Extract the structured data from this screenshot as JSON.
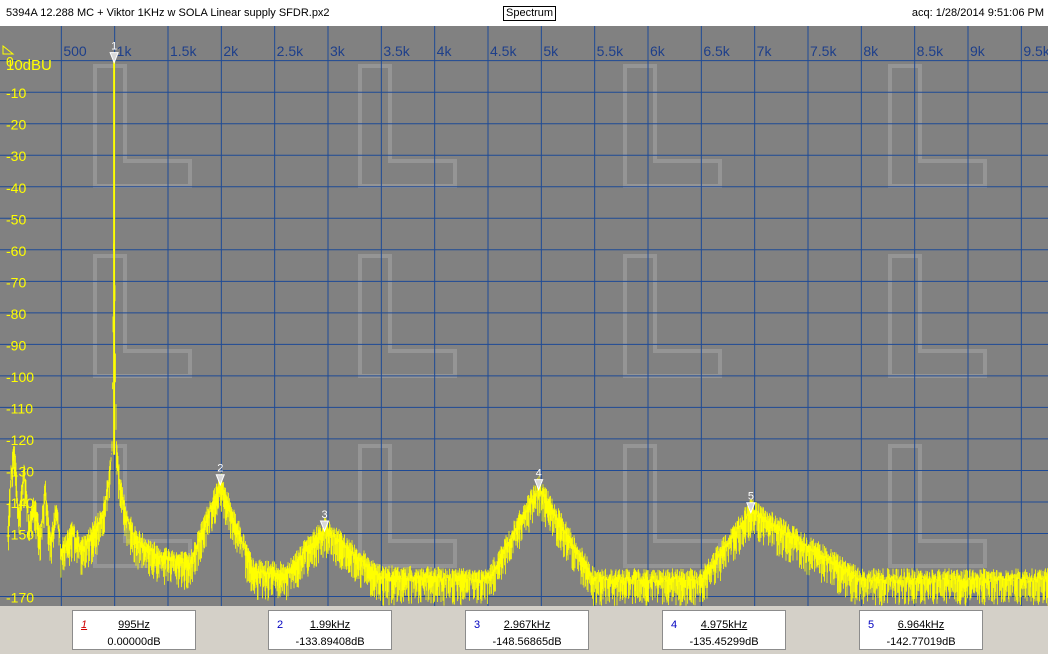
{
  "window": {
    "file_title": "5394A 12.288 MC + Viktor 1KHz w SOLA Linear supply SFDR.px2",
    "view_label": "Spectrum",
    "acq_label": "acq: 1/28/2014 9:51:06 PM"
  },
  "colors": {
    "plot_background": "#818181",
    "grid": "#1e4a96",
    "trace": "#ffff00",
    "axis_text_y": "#ffff00",
    "axis_text_x": "#1e3f8a"
  },
  "chart_data": {
    "type": "line",
    "title": "",
    "y_unit_label": "10dBU",
    "xlim": [
      0,
      9750
    ],
    "ylim": [
      -173,
      11
    ],
    "x_ticks": [
      {
        "value": 500,
        "label": "500"
      },
      {
        "value": 1000,
        "label": "1k"
      },
      {
        "value": 1500,
        "label": "1.5k"
      },
      {
        "value": 2000,
        "label": "2k"
      },
      {
        "value": 2500,
        "label": "2.5k"
      },
      {
        "value": 3000,
        "label": "3k"
      },
      {
        "value": 3500,
        "label": "3.5k"
      },
      {
        "value": 4000,
        "label": "4k"
      },
      {
        "value": 4500,
        "label": "4.5k"
      },
      {
        "value": 5000,
        "label": "5k"
      },
      {
        "value": 5500,
        "label": "5.5k"
      },
      {
        "value": 6000,
        "label": "6k"
      },
      {
        "value": 6500,
        "label": "6.5k"
      },
      {
        "value": 7000,
        "label": "7k"
      },
      {
        "value": 7500,
        "label": "7.5k"
      },
      {
        "value": 8000,
        "label": "8k"
      },
      {
        "value": 8500,
        "label": "8.5k"
      },
      {
        "value": 9000,
        "label": "9k"
      },
      {
        "value": 9500,
        "label": "9.5k"
      }
    ],
    "y_ticks": [
      {
        "value": 0,
        "label": "0"
      },
      {
        "value": -10,
        "label": "-10"
      },
      {
        "value": -20,
        "label": "-20"
      },
      {
        "value": -30,
        "label": "-30"
      },
      {
        "value": -40,
        "label": "-40"
      },
      {
        "value": -50,
        "label": "-50"
      },
      {
        "value": -60,
        "label": "-60"
      },
      {
        "value": -70,
        "label": "-70"
      },
      {
        "value": -80,
        "label": "-80"
      },
      {
        "value": -90,
        "label": "-90"
      },
      {
        "value": -100,
        "label": "-100"
      },
      {
        "value": -110,
        "label": "-110"
      },
      {
        "value": -120,
        "label": "-120"
      },
      {
        "value": -130,
        "label": "-130"
      },
      {
        "value": -140,
        "label": "-140"
      },
      {
        "value": -150,
        "label": "-150"
      },
      {
        "value": -170,
        "label": "-170"
      }
    ],
    "grid": true,
    "noise_floor_db": -164,
    "series": [
      {
        "values": [
          {
            "x": 0,
            "y": -150
          },
          {
            "x": 20,
            "y": -135
          },
          {
            "x": 60,
            "y": -122
          },
          {
            "x": 100,
            "y": -146
          },
          {
            "x": 150,
            "y": -130
          },
          {
            "x": 200,
            "y": -148
          },
          {
            "x": 250,
            "y": -140
          },
          {
            "x": 300,
            "y": -152
          },
          {
            "x": 350,
            "y": -136
          },
          {
            "x": 400,
            "y": -154
          },
          {
            "x": 450,
            "y": -142
          },
          {
            "x": 500,
            "y": -156
          },
          {
            "x": 600,
            "y": -150
          },
          {
            "x": 700,
            "y": -155
          },
          {
            "x": 800,
            "y": -150
          },
          {
            "x": 880,
            "y": -145
          },
          {
            "x": 940,
            "y": -135
          },
          {
            "x": 975,
            "y": -123
          },
          {
            "x": 988,
            "y": -70
          },
          {
            "x": 995,
            "y": 0
          },
          {
            "x": 1002,
            "y": -70
          },
          {
            "x": 1015,
            "y": -123
          },
          {
            "x": 1050,
            "y": -135
          },
          {
            "x": 1110,
            "y": -145
          },
          {
            "x": 1200,
            "y": -152
          },
          {
            "x": 1400,
            "y": -157
          },
          {
            "x": 1700,
            "y": -160
          },
          {
            "x": 1990,
            "y": -133.9
          },
          {
            "x": 2300,
            "y": -162
          },
          {
            "x": 2600,
            "y": -163
          },
          {
            "x": 2967,
            "y": -148.6
          },
          {
            "x": 3500,
            "y": -164
          },
          {
            "x": 4500,
            "y": -165
          },
          {
            "x": 4975,
            "y": -135.5
          },
          {
            "x": 5500,
            "y": -165
          },
          {
            "x": 6500,
            "y": -165
          },
          {
            "x": 6964,
            "y": -142.8
          },
          {
            "x": 8000,
            "y": -165
          },
          {
            "x": 9000,
            "y": -165
          },
          {
            "x": 9750,
            "y": -165
          }
        ]
      }
    ],
    "markers": [
      {
        "id": "1",
        "freq": 995,
        "freq_label": "995Hz",
        "level": 0.0,
        "level_label": "0.00000dB"
      },
      {
        "id": "2",
        "freq": 1990,
        "freq_label": "1.99kHz",
        "level": -133.89408,
        "level_label": "-133.89408dB"
      },
      {
        "id": "3",
        "freq": 2967,
        "freq_label": "2.967kHz",
        "level": -148.56865,
        "level_label": "-148.56865dB"
      },
      {
        "id": "4",
        "freq": 4975,
        "freq_label": "4.975kHz",
        "level": -135.45299,
        "level_label": "-135.45299dB"
      },
      {
        "id": "5",
        "freq": 6964,
        "freq_label": "6.964kHz",
        "level": -142.77019,
        "level_label": "-142.77019dB"
      }
    ]
  }
}
